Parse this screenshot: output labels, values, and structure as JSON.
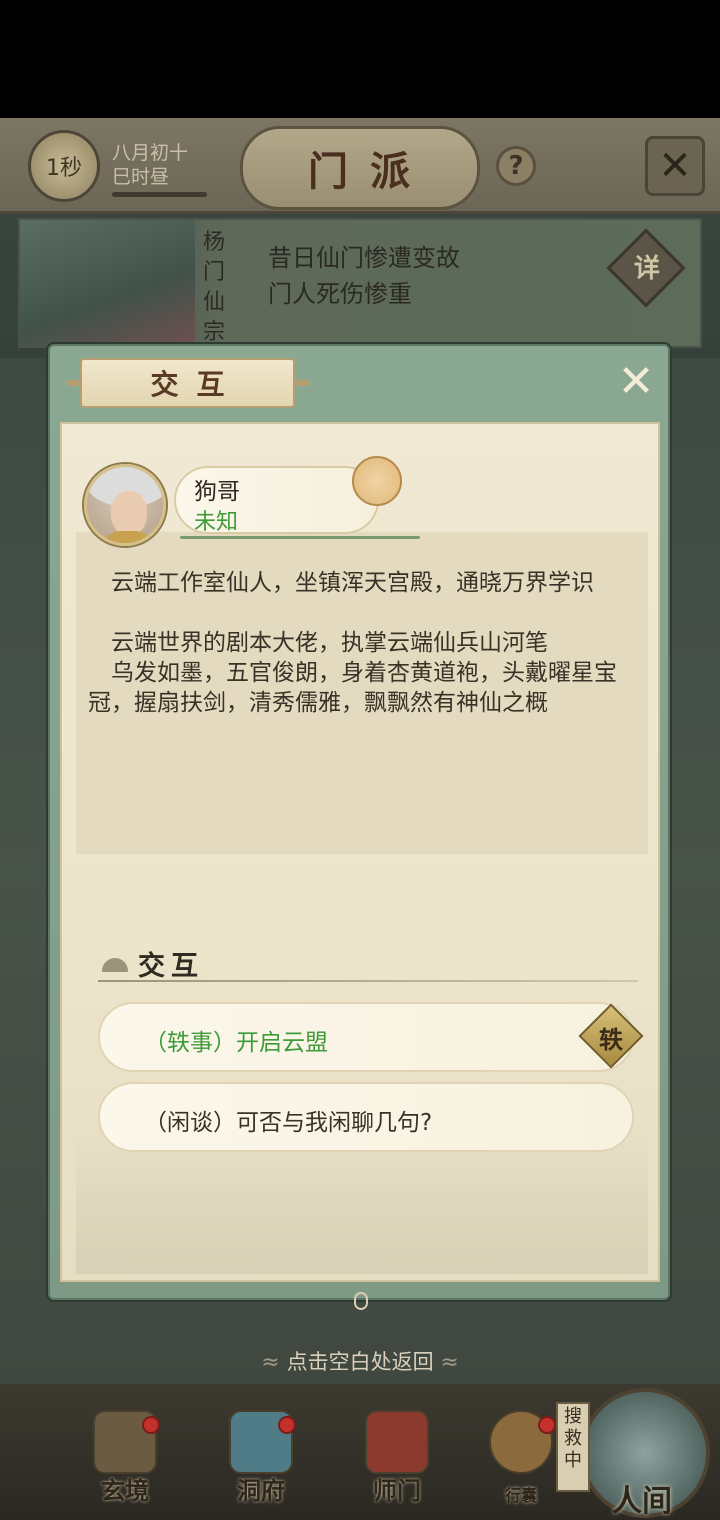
{
  "header": {
    "time_badge": "1秒",
    "date_line1": "八月初十",
    "date_line2": "巳时昼",
    "title": "门派",
    "help_icon": "?",
    "close_icon": "✕"
  },
  "sect_banner": {
    "name": "杨门仙宗",
    "line1": "昔日仙门惨遭变故",
    "line2": "门人死伤惨重",
    "detail_label": "详"
  },
  "dialog": {
    "title": "交互",
    "close_icon": "✕",
    "npc": {
      "name": "狗哥",
      "status": "未知",
      "status_color": "#3f9b3a"
    },
    "description": [
      "云端工作室仙人，坐镇浑天宫殿，通晓万界学识",
      "云端世界的剧本大佬，执掌云端仙兵山河笔",
      "乌发如墨，五官俊朗，身着杏黄道袍，头戴曜星宝冠，握扇扶剑，清秀儒雅，飘飘然有神仙之概"
    ],
    "section_title": "交互",
    "options": [
      {
        "label": "（轶事）开启云盟",
        "badge": "轶",
        "color": "#3f9b3a"
      },
      {
        "label": "（闲谈）可否与我闲聊几句?",
        "color": "#3a3127"
      }
    ]
  },
  "hint": "点击空白处返回",
  "bottom_nav": {
    "items": [
      {
        "label": "玄境",
        "has_dot": true
      },
      {
        "label": "洞府",
        "has_dot": true
      },
      {
        "label": "师门",
        "has_dot": false
      },
      {
        "label": "行囊",
        "has_dot": true
      }
    ],
    "search_badge": "搜救中",
    "world_label": "人间"
  }
}
